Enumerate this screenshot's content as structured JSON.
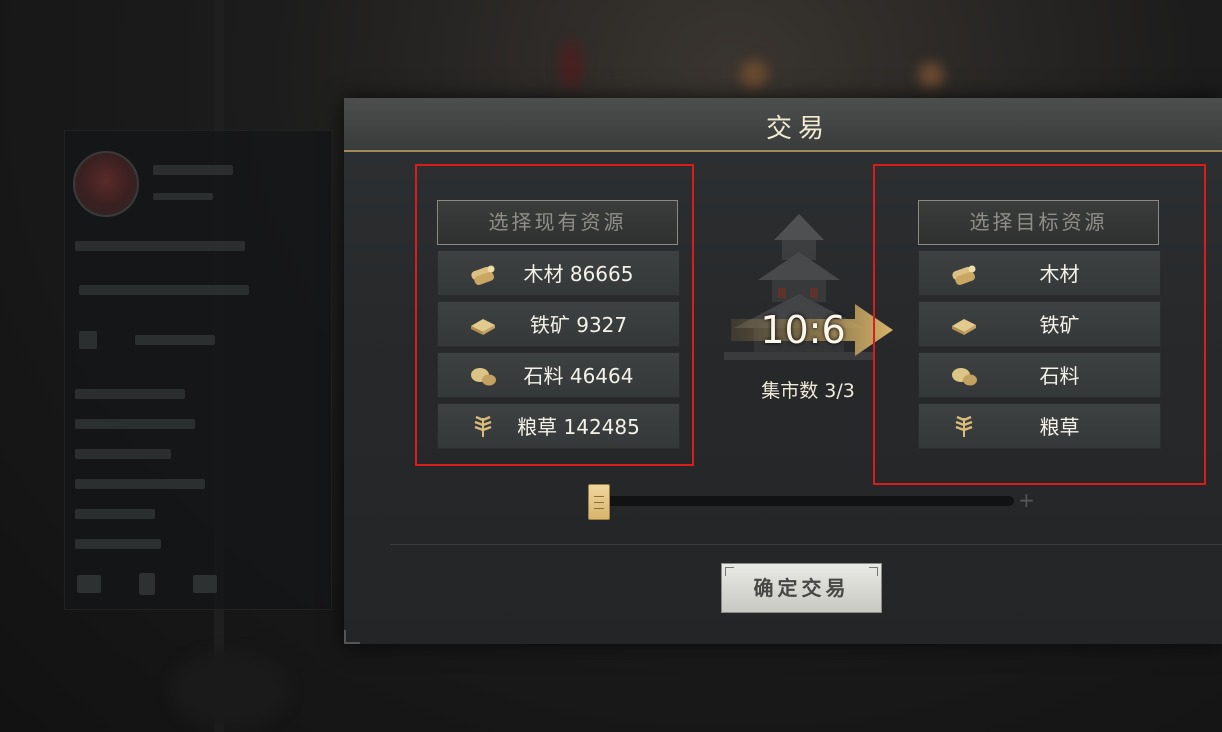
{
  "dialog": {
    "title": "交易",
    "source": {
      "header": "选择现有资源",
      "items": [
        {
          "icon": "wood-icon",
          "label": "木材 86665"
        },
        {
          "icon": "iron-ore-icon",
          "label": "铁矿 9327"
        },
        {
          "icon": "stone-icon",
          "label": "石料 46464"
        },
        {
          "icon": "grain-icon",
          "label": "粮草 142485"
        }
      ]
    },
    "target": {
      "header": "选择目标资源",
      "items": [
        {
          "icon": "wood-icon",
          "label": "木材"
        },
        {
          "icon": "iron-ore-icon",
          "label": "铁矿"
        },
        {
          "icon": "stone-icon",
          "label": "石料"
        },
        {
          "icon": "grain-icon",
          "label": "粮草"
        }
      ]
    },
    "rate": "10:6",
    "market_count": "集市数 3/3",
    "slider": {
      "value": 0,
      "plus_label": "+"
    },
    "confirm_label": "确定交易"
  },
  "colors": {
    "accent_gold": "#d8b56a",
    "highlight_red": "#d81d1d",
    "title_text": "#f3ead2"
  }
}
